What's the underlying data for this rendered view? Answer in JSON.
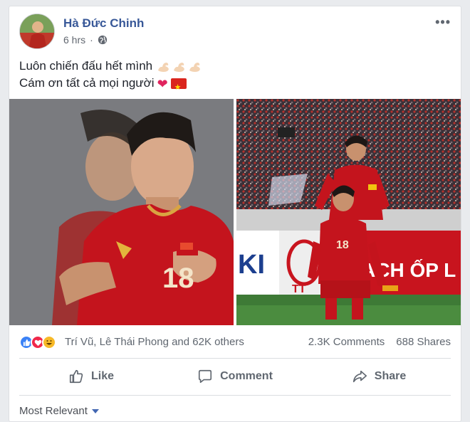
{
  "post": {
    "author": "Hà Đức Chinh",
    "time": "6 hrs",
    "privacy_icon": "globe-icon",
    "more_label": "•••",
    "line1": "Luôn chiến đấu hết mình",
    "line2": "Cám ơn tất cả mọi người",
    "photo_left": {
      "jersey_number": "18"
    },
    "photo_right": {
      "jersey_number": "18",
      "banner_text_left": "KI",
      "banner_text_right": "ACH ỐP L",
      "board_text": "TT"
    }
  },
  "engagement": {
    "reaction_names": "Trí Vũ, Lê Thái Phong and 62K others",
    "comments": "2.3K Comments",
    "shares": "688 Shares"
  },
  "actions": {
    "like": "Like",
    "comment": "Comment",
    "share": "Share"
  },
  "comments_sort": {
    "label": "Most Relevant"
  },
  "colors": {
    "link_blue": "#385898",
    "meta_grey": "#616770",
    "jersey_red": "#c4141d",
    "love_red": "#f0284a",
    "like_blue": "#3b82f6"
  }
}
